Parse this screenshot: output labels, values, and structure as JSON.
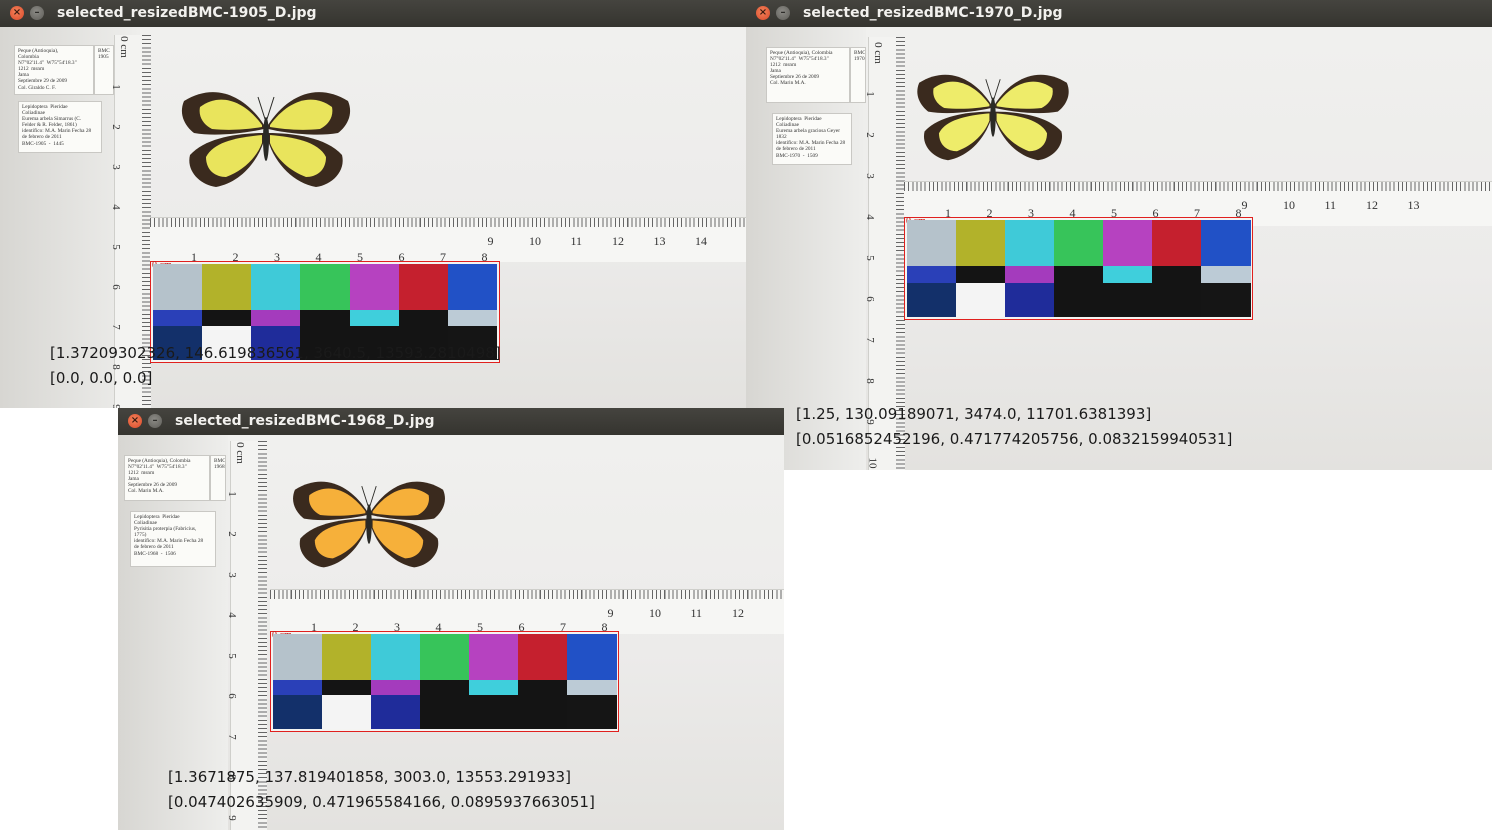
{
  "windows": [
    {
      "title": "selected_resizedBMC-1905_D.jpg",
      "label_locality": "Peque (Antioquia),\nColombia\nN7°02'11.4\"  W75°54'18.3\"\n1212  msnm\nJama\nSeptiembre 29 de 2009\nCol. Giraldo C. F.",
      "label_side": "BMC\n1905",
      "label_taxon": "Lepidoptera  Pieridae\nColiadinae\nEurema arbela Simarrus (C.\nFelder & R. Felder, 1861)\nidentifico: M.A. Marin Fecha 28\nde febrero de 2011\nBMC-1905  -  1445",
      "v_ticks": [
        "0 cm",
        "1",
        "2",
        "3",
        "4",
        "5",
        "6",
        "7",
        "8",
        "9"
      ],
      "h_ticks": [
        "9",
        "10",
        "11",
        "12",
        "13",
        "14"
      ],
      "card_cm": "0 cm",
      "card_ticks": [
        "1",
        "2",
        "3",
        "4",
        "5",
        "6",
        "7",
        "8"
      ],
      "line1": "[1.37209302326, 146.619836561, 3640.5, 13593.2810498]",
      "line2": "[0.0, 0.0, 0.0]",
      "wing_color": "#e9e45c",
      "border_color": "#3a2a1e"
    },
    {
      "title": "selected_resizedBMC-1970_D.jpg",
      "label_locality": "Peque (Antioquia), Colombia\nN7°02'11.4\"  W75°54'18.3\"\n1212  msnm\nJama\nSeptiembre 26 de 2009\nCol. Marin M.A.",
      "label_side": "BMC\n1970",
      "label_taxon": "Lepidoptera  Pieridae\nColiadinae\nEurema arbela graciosa Geyer\n1832\nidentifico: M.A. Marin Fecha 28\nde febrero de 2011\nBMC-1970  -  1509",
      "v_ticks": [
        "0 cm",
        "1",
        "2",
        "3",
        "4",
        "5",
        "6",
        "7",
        "8",
        "9",
        "10"
      ],
      "h_ticks": [
        "9",
        "10",
        "11",
        "12",
        "13"
      ],
      "card_cm": "0 cm",
      "card_ticks": [
        "1",
        "2",
        "3",
        "4",
        "5",
        "6",
        "7",
        "8"
      ],
      "line1": "[1.25, 130.09189071, 3474.0, 11701.6381393]",
      "line2": "[0.0516852452196, 0.471774205756, 0.0832159940531]",
      "wing_color": "#eeec6a",
      "border_color": "#3a2a1e"
    },
    {
      "title": "selected_resizedBMC-1968_D.jpg",
      "label_locality": "Peque (Antioquia), Colombia\nN7°02'11.4\"  W75°54'18.3\"\n1212  msnm\nJama\nSeptiembre 26 de 2009\nCol. Marin M.A.",
      "label_side": "BMC\n1968",
      "label_taxon": "Lepidoptera  Pieridae\nColiadinae\nPyrisitia proterpia (Fabricius,\n1775)\nidentifico: M.A. Marin Fecha 28\nde febrero de 2011\nBMC-1968  -  1506",
      "v_ticks": [
        "0 cm",
        "1",
        "2",
        "3",
        "4",
        "5",
        "6",
        "7",
        "8",
        "9"
      ],
      "h_ticks": [
        "9",
        "10",
        "11",
        "12"
      ],
      "card_cm": "0 cm",
      "card_ticks": [
        "1",
        "2",
        "3",
        "4",
        "5",
        "6",
        "7",
        "8"
      ],
      "line1": "[1.3671875, 137.819401858, 3003.0, 13553.291933]",
      "line2": "[0.047402635909, 0.471965584166, 0.0895937663051]",
      "wing_color": "#f6b03a",
      "border_color": "#3a2a1e"
    }
  ],
  "colors": {
    "top_row": [
      "#b5c2cb",
      "#b2b22a",
      "#3fcad8",
      "#37c45a",
      "#b642c0",
      "#c5202e",
      "#2151c6"
    ],
    "mid_row": [
      "#2a40b8",
      "#141414",
      "#a43bbd",
      "#141414",
      "#3fcfdc",
      "#141414",
      "#bccbd6"
    ],
    "bottom_row": [
      "#13306a",
      "#f4f4f4",
      "#1f2c9a",
      "#141414",
      "#141414",
      "#141414",
      "#151515"
    ],
    "close_btn": "#e0552f",
    "titlebar": "#3c3b37"
  },
  "buttons": {
    "close_symbol": "×",
    "min_symbol": "–"
  }
}
